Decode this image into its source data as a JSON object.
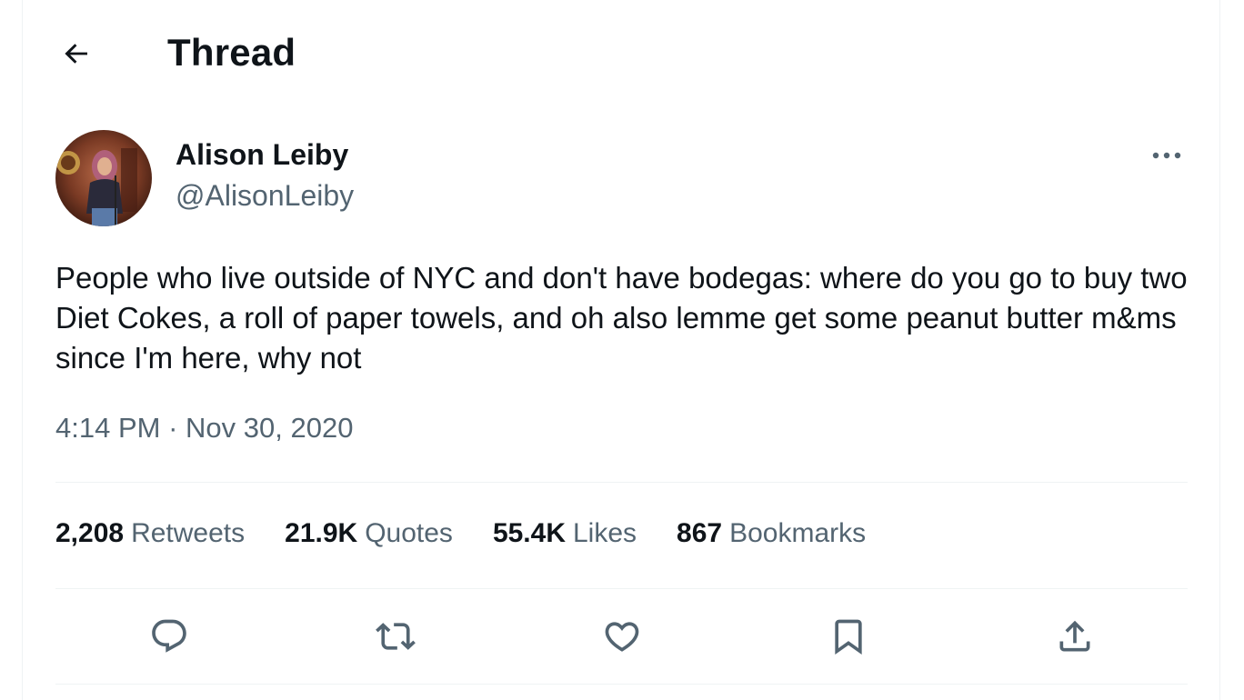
{
  "header": {
    "back_icon": "back-arrow-icon",
    "title": "Thread"
  },
  "tweet": {
    "author": {
      "display_name": "Alison Leiby",
      "handle": "@AlisonLeiby"
    },
    "more_icon": "more-horizontal-icon",
    "text": "People who live outside of NYC and don't have bodegas: where do you go to buy two Diet Cokes, a roll of paper towels, and oh also lemme get some peanut butter m&ms since I'm here, why not",
    "time": "4:14 PM",
    "separator": "·",
    "date": "Nov 30, 2020"
  },
  "stats": {
    "retweets": {
      "count": "2,208",
      "label": "Retweets"
    },
    "quotes": {
      "count": "21.9K",
      "label": "Quotes"
    },
    "likes": {
      "count": "55.4K",
      "label": "Likes"
    },
    "bookmarks": {
      "count": "867",
      "label": "Bookmarks"
    }
  },
  "actions": {
    "reply_icon": "reply-icon",
    "retweet_icon": "retweet-icon",
    "like_icon": "like-heart-icon",
    "bookmark_icon": "bookmark-icon",
    "share_icon": "share-icon"
  },
  "colors": {
    "text_primary": "#0f1419",
    "text_secondary": "#536471",
    "divider": "#eff3f4"
  }
}
